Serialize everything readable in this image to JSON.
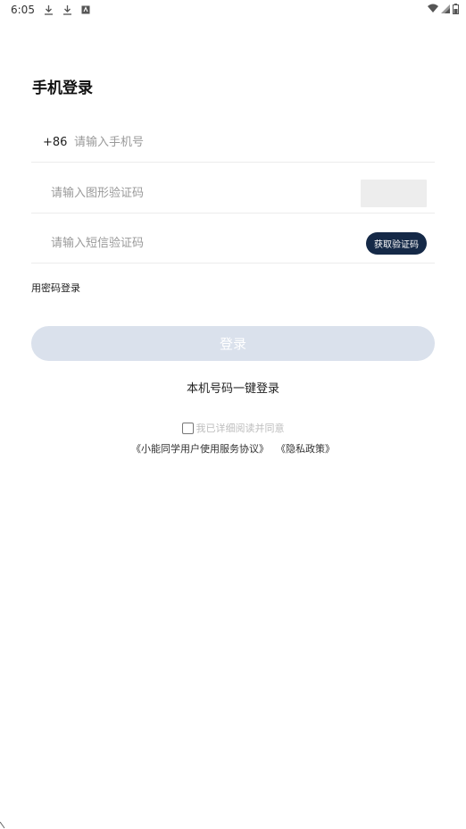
{
  "status_bar": {
    "time": "6:05",
    "icons_left": [
      "download-icon",
      "download-icon",
      "app-notification-icon"
    ],
    "icons_right": [
      "wifi-icon",
      "cellular-signal-icon",
      "battery-icon"
    ]
  },
  "title": "手机登录",
  "phone": {
    "prefix": "+86",
    "placeholder": "请输入手机号"
  },
  "captcha": {
    "placeholder": "请输入图形验证码"
  },
  "sms": {
    "placeholder": "请输入短信验证码",
    "button_label": "获取验证码"
  },
  "password_login_label": "用密码登录",
  "login_button_label": "登录",
  "oneclick_label": "本机号码一键登录",
  "agreement": {
    "checkbox_label": "我已详细阅读并同意",
    "checked": false,
    "service_link": "《小能同学用户使用服务协议》",
    "privacy_link": "《隐私政策》"
  },
  "colors": {
    "accent_dark": "#152947",
    "login_disabled_bg": "#dae1ec",
    "placeholder": "#9a9a9a",
    "divider": "#ececec"
  }
}
